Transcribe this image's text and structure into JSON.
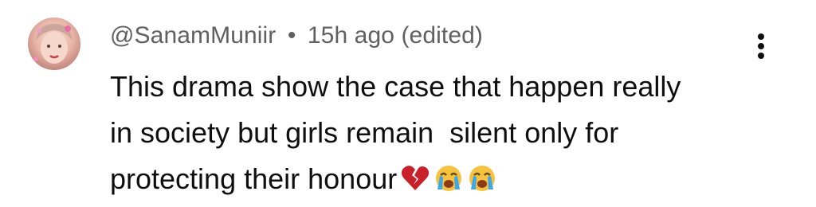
{
  "comment": {
    "author": "@SanamMuniir",
    "separator": "•",
    "time": "15h ago",
    "edited": "(edited)",
    "lines": [
      "This drama show the case that happen really",
      "in society but girls remain  silent only for",
      "protecting their honour"
    ],
    "emojis": [
      "broken-heart-icon",
      "loudly-crying-face-icon",
      "loudly-crying-face-icon"
    ]
  },
  "colors": {
    "meta_text": "#606060",
    "body_text": "#0f0f0f",
    "heart": "#c9202a",
    "emoji_face": "#f7c23e",
    "tears": "#3ea7e8"
  }
}
